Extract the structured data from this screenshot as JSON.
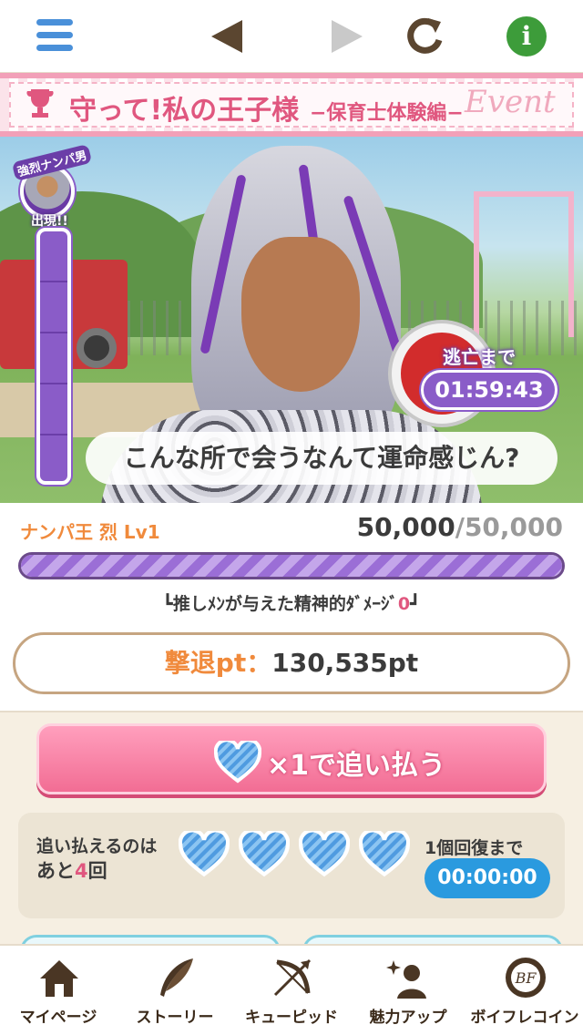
{
  "toolbar": {
    "menu_icon": "hamburger-menu-icon",
    "back_icon": "back-arrow-icon",
    "forward_icon": "forward-arrow-icon",
    "reload_icon": "reload-icon",
    "info_icon": "info-icon",
    "info_glyph": "i"
  },
  "event": {
    "title": "守って!私の王子様",
    "subtitle": "−保育士体験編−",
    "script": "Event"
  },
  "gauge": {
    "label_top": "強烈ナンパ男",
    "label_bottom": "出現!!",
    "segments": 5
  },
  "escape": {
    "label": "逃亡まで",
    "time": "01:59:43"
  },
  "speech": "こんな所で会うなんて運命感じん?",
  "boss": {
    "name": "ナンパ王 烈 Lv1",
    "hp_current": "50,000",
    "hp_max": "/50,000",
    "hp_fraction": 1.0
  },
  "damage": {
    "prefix": "┗推しﾒﾝが与えた精神的ﾀﾞﾒｰｼﾞ",
    "value": "0",
    "suffix": "┛"
  },
  "repel": {
    "label": "撃退pt：",
    "value": "130,535pt"
  },
  "chase_button": {
    "label": "×1で追い払う"
  },
  "remaining": {
    "line1": "追い払えるのは",
    "line2_prefix": "あと",
    "count": "4",
    "line2_suffix": "回",
    "hearts": 4
  },
  "recovery": {
    "label": "1個回復まで",
    "time": "00:00:00"
  },
  "nav": [
    {
      "label": "マイページ",
      "icon": "home-icon"
    },
    {
      "label": "ストーリー",
      "icon": "quill-icon"
    },
    {
      "label": "キューピッド",
      "icon": "bow-arrow-icon"
    },
    {
      "label": "魅力アップ",
      "icon": "sparkle-person-icon"
    },
    {
      "label": "ボイフレコイン",
      "icon": "bf-coin-icon"
    }
  ],
  "colors": {
    "accent_pink": "#e0577f",
    "accent_purple": "#8a5cc8",
    "accent_orange": "#f08a3c",
    "timer_blue": "#2a9adf"
  }
}
